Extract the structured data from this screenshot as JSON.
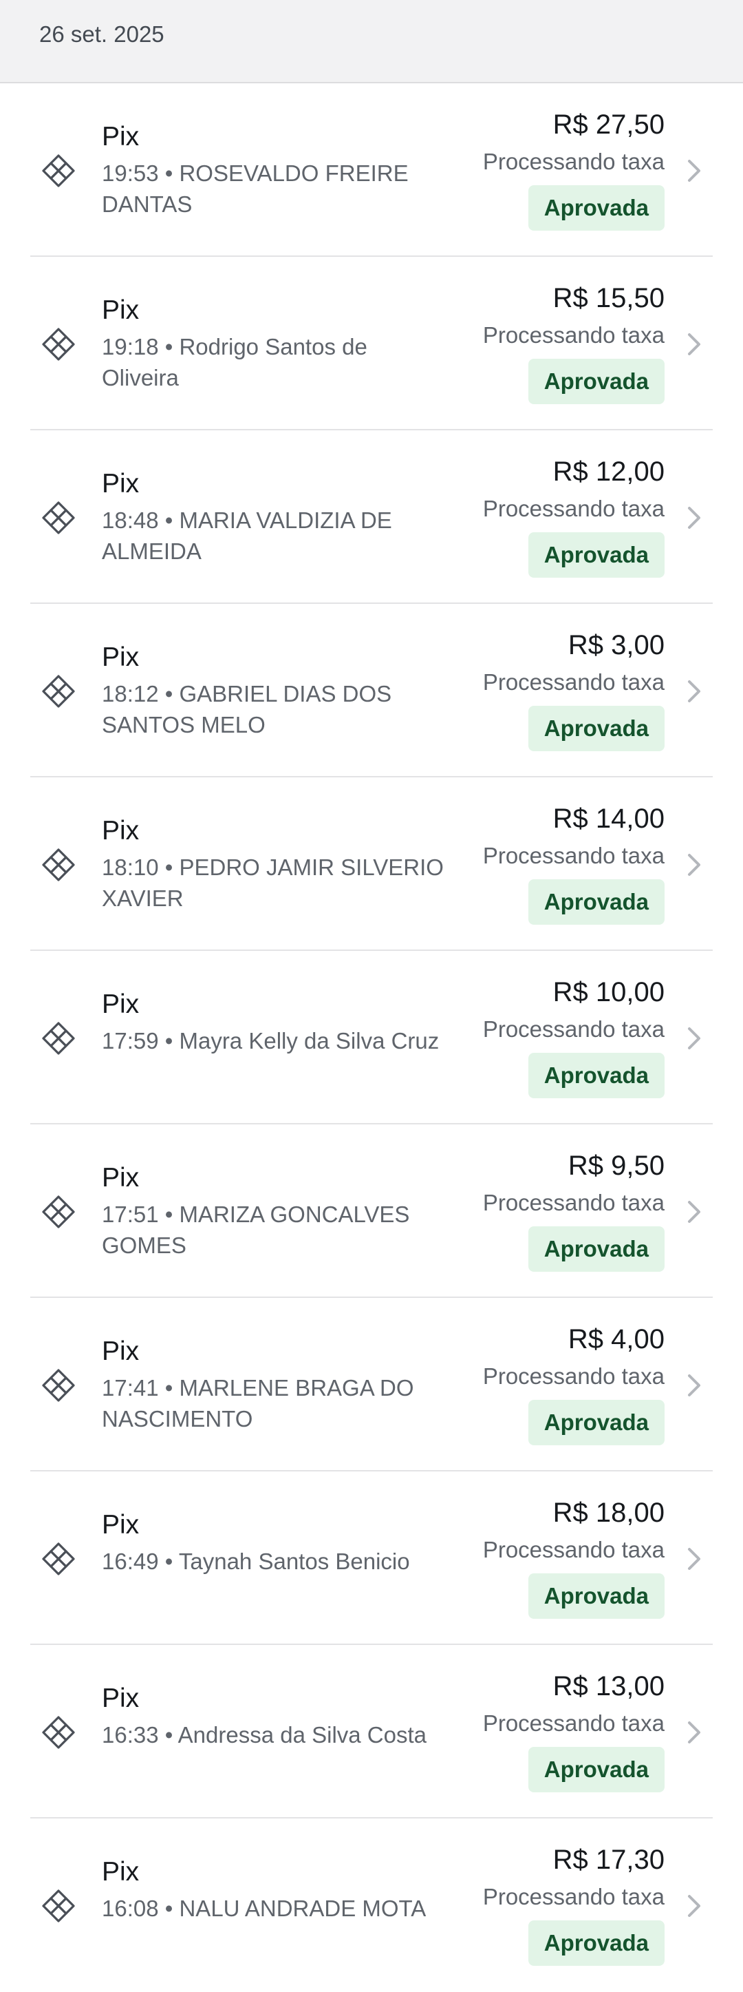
{
  "date_header": "26 set. 2025",
  "transactions": [
    {
      "title": "Pix",
      "subtitle": "19:53 • ROSEVALDO FREIRE DANTAS",
      "amount": "R$ 27,50",
      "fee_status": "Processando taxa",
      "status": "Aprovada"
    },
    {
      "title": "Pix",
      "subtitle": "19:18 • Rodrigo Santos de Oliveira",
      "amount": "R$ 15,50",
      "fee_status": "Processando taxa",
      "status": "Aprovada"
    },
    {
      "title": "Pix",
      "subtitle": "18:48 • MARIA VALDIZIA DE ALMEIDA",
      "amount": "R$ 12,00",
      "fee_status": "Processando taxa",
      "status": "Aprovada"
    },
    {
      "title": "Pix",
      "subtitle": "18:12 • GABRIEL DIAS DOS SANTOS MELO",
      "amount": "R$ 3,00",
      "fee_status": "Processando taxa",
      "status": "Aprovada"
    },
    {
      "title": "Pix",
      "subtitle": "18:10 • PEDRO JAMIR SILVERIO XAVIER",
      "amount": "R$ 14,00",
      "fee_status": "Processando taxa",
      "status": "Aprovada"
    },
    {
      "title": "Pix",
      "subtitle": "17:59 • Mayra Kelly da Silva Cruz",
      "amount": "R$ 10,00",
      "fee_status": "Processando taxa",
      "status": "Aprovada"
    },
    {
      "title": "Pix",
      "subtitle": "17:51 • MARIZA GONCALVES GOMES",
      "amount": "R$ 9,50",
      "fee_status": "Processando taxa",
      "status": "Aprovada"
    },
    {
      "title": "Pix",
      "subtitle": "17:41 • MARLENE BRAGA DO NASCIMENTO",
      "amount": "R$ 4,00",
      "fee_status": "Processando taxa",
      "status": "Aprovada"
    },
    {
      "title": "Pix",
      "subtitle": "16:49 • Taynah Santos Benicio",
      "amount": "R$ 18,00",
      "fee_status": "Processando taxa",
      "status": "Aprovada"
    },
    {
      "title": "Pix",
      "subtitle": "16:33 • Andressa da Silva Costa",
      "amount": "R$ 13,00",
      "fee_status": "Processando taxa",
      "status": "Aprovada"
    },
    {
      "title": "Pix",
      "subtitle": "16:08 • NALU ANDRADE MOTA",
      "amount": "R$ 17,30",
      "fee_status": "Processando taxa",
      "status": "Aprovada"
    }
  ],
  "icons": {
    "payment": "pix-icon",
    "navigate": "chevron-right-icon"
  },
  "colors": {
    "status_badge_bg": "#e2f4e7",
    "status_badge_text": "#14532d",
    "header_bg": "#f2f2f3"
  }
}
